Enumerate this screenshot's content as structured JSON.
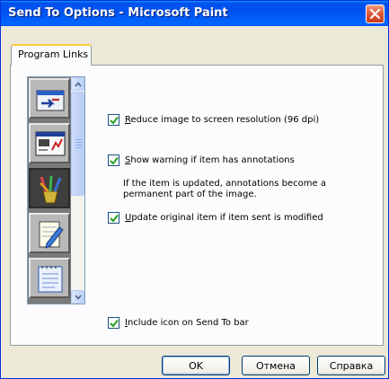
{
  "window": {
    "title": "Send To Options - Microsoft Paint",
    "close_icon": "close-icon"
  },
  "tabs": [
    {
      "label": "Program Links",
      "active": true
    }
  ],
  "icon_list": {
    "items": [
      {
        "icon": "send-transfer-icon",
        "selected": false
      },
      {
        "icon": "presentation-chart-icon",
        "selected": false
      },
      {
        "icon": "paint-brushes-icon",
        "selected": true
      },
      {
        "icon": "notepad-pencil-icon",
        "selected": false
      },
      {
        "icon": "notebook-icon",
        "selected": false
      }
    ]
  },
  "options": {
    "reduce_image": {
      "pre": "",
      "accel": "R",
      "post": "educe image to screen resolution (96 dpi)",
      "checked": true
    },
    "show_warning": {
      "pre": "",
      "accel": "S",
      "post": "how warning if item has annotations",
      "checked": true
    },
    "info_text": "If the item is updated, annotations become a permanent part of the image.",
    "update_original": {
      "pre": "",
      "accel": "U",
      "post": "pdate original item if item sent is modified",
      "checked": true
    },
    "include_icon": {
      "pre": "",
      "accel": "I",
      "post": "nclude icon on Send To bar",
      "checked": true
    }
  },
  "buttons": {
    "ok": "OK",
    "cancel": "Отмена",
    "help": "Справка"
  },
  "colors": {
    "titlebar": "#0054e3",
    "dialog_bg": "#ece9d8",
    "close_red": "#e05a36",
    "tab_highlight": "#ffc83c"
  }
}
